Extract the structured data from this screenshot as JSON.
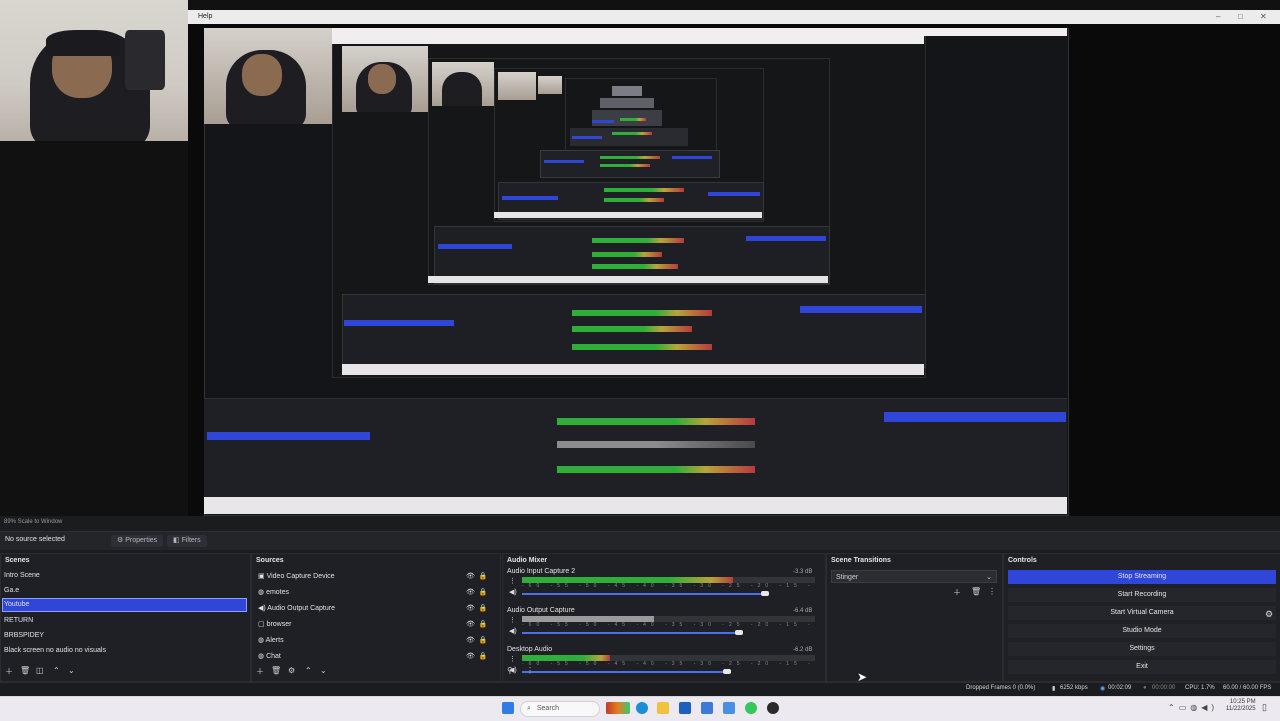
{
  "captured_window": {
    "menu_help": "Help",
    "window_controls": [
      "–",
      "□",
      "✕"
    ]
  },
  "preview": {
    "scale_label": "89%  Scale to Window"
  },
  "properties_bar": {
    "no_source": "No source selected",
    "properties": "Properties",
    "filters": "Filters"
  },
  "scenes": {
    "title": "Scenes",
    "items": [
      "Intro Scene",
      "Ga.e",
      "Youtube",
      "RETURN",
      "BRBSPIDEY",
      "Black screen no audio no visuals"
    ],
    "selected_index": 2
  },
  "sources": {
    "title": "Sources",
    "items": [
      {
        "label": "Video Capture Device",
        "icon": "camera-icon"
      },
      {
        "label": "emotes",
        "icon": "browser-icon"
      },
      {
        "label": "Audio Output Capture",
        "icon": "speaker-icon"
      },
      {
        "label": "browser",
        "icon": "browser-icon"
      },
      {
        "label": "Alerts",
        "icon": "browser-icon"
      },
      {
        "label": "Chat",
        "icon": "browser-icon"
      }
    ]
  },
  "mixer": {
    "title": "Audio Mixer",
    "channels": [
      {
        "name": "Audio Input Capture 2",
        "db": "-3.3 dB",
        "level": 0.72,
        "volume": 0.83
      },
      {
        "name": "Audio Output Capture",
        "db": "-6.4 dB",
        "level": 0.45,
        "volume": 0.74
      },
      {
        "name": "Desktop Audio",
        "db": "-6.2 dB",
        "level": 0.3,
        "volume": 0.7
      }
    ],
    "scale_ticks": "-60 -55 -50 -45 -40 -35 -30 -25 -20 -15 -10 -5 0"
  },
  "transitions": {
    "title": "Scene Transitions",
    "selected": "Stinger"
  },
  "controls": {
    "title": "Controls",
    "buttons": [
      "Stop Streaming",
      "Start Recording",
      "Start Virtual Camera",
      "Studio Mode",
      "Settings",
      "Exit"
    ],
    "active_index": 0
  },
  "status": {
    "dropped_frames": "Dropped Frames 0 (0.0%)",
    "kbps": "6252 kbps",
    "stream_time": "00:02:09",
    "rec_time": "00:00:00",
    "cpu": "CPU: 1.7%",
    "fps": "60.00 / 60.00 FPS"
  },
  "taskbar": {
    "search": "Search",
    "time": "10:25 PM",
    "date": "11/22/2025"
  },
  "colors": {
    "accent": "#2f46d8",
    "meter_green": "#2fae3a",
    "meter_yellow": "#b9a33a",
    "meter_red": "#b53b3b"
  }
}
